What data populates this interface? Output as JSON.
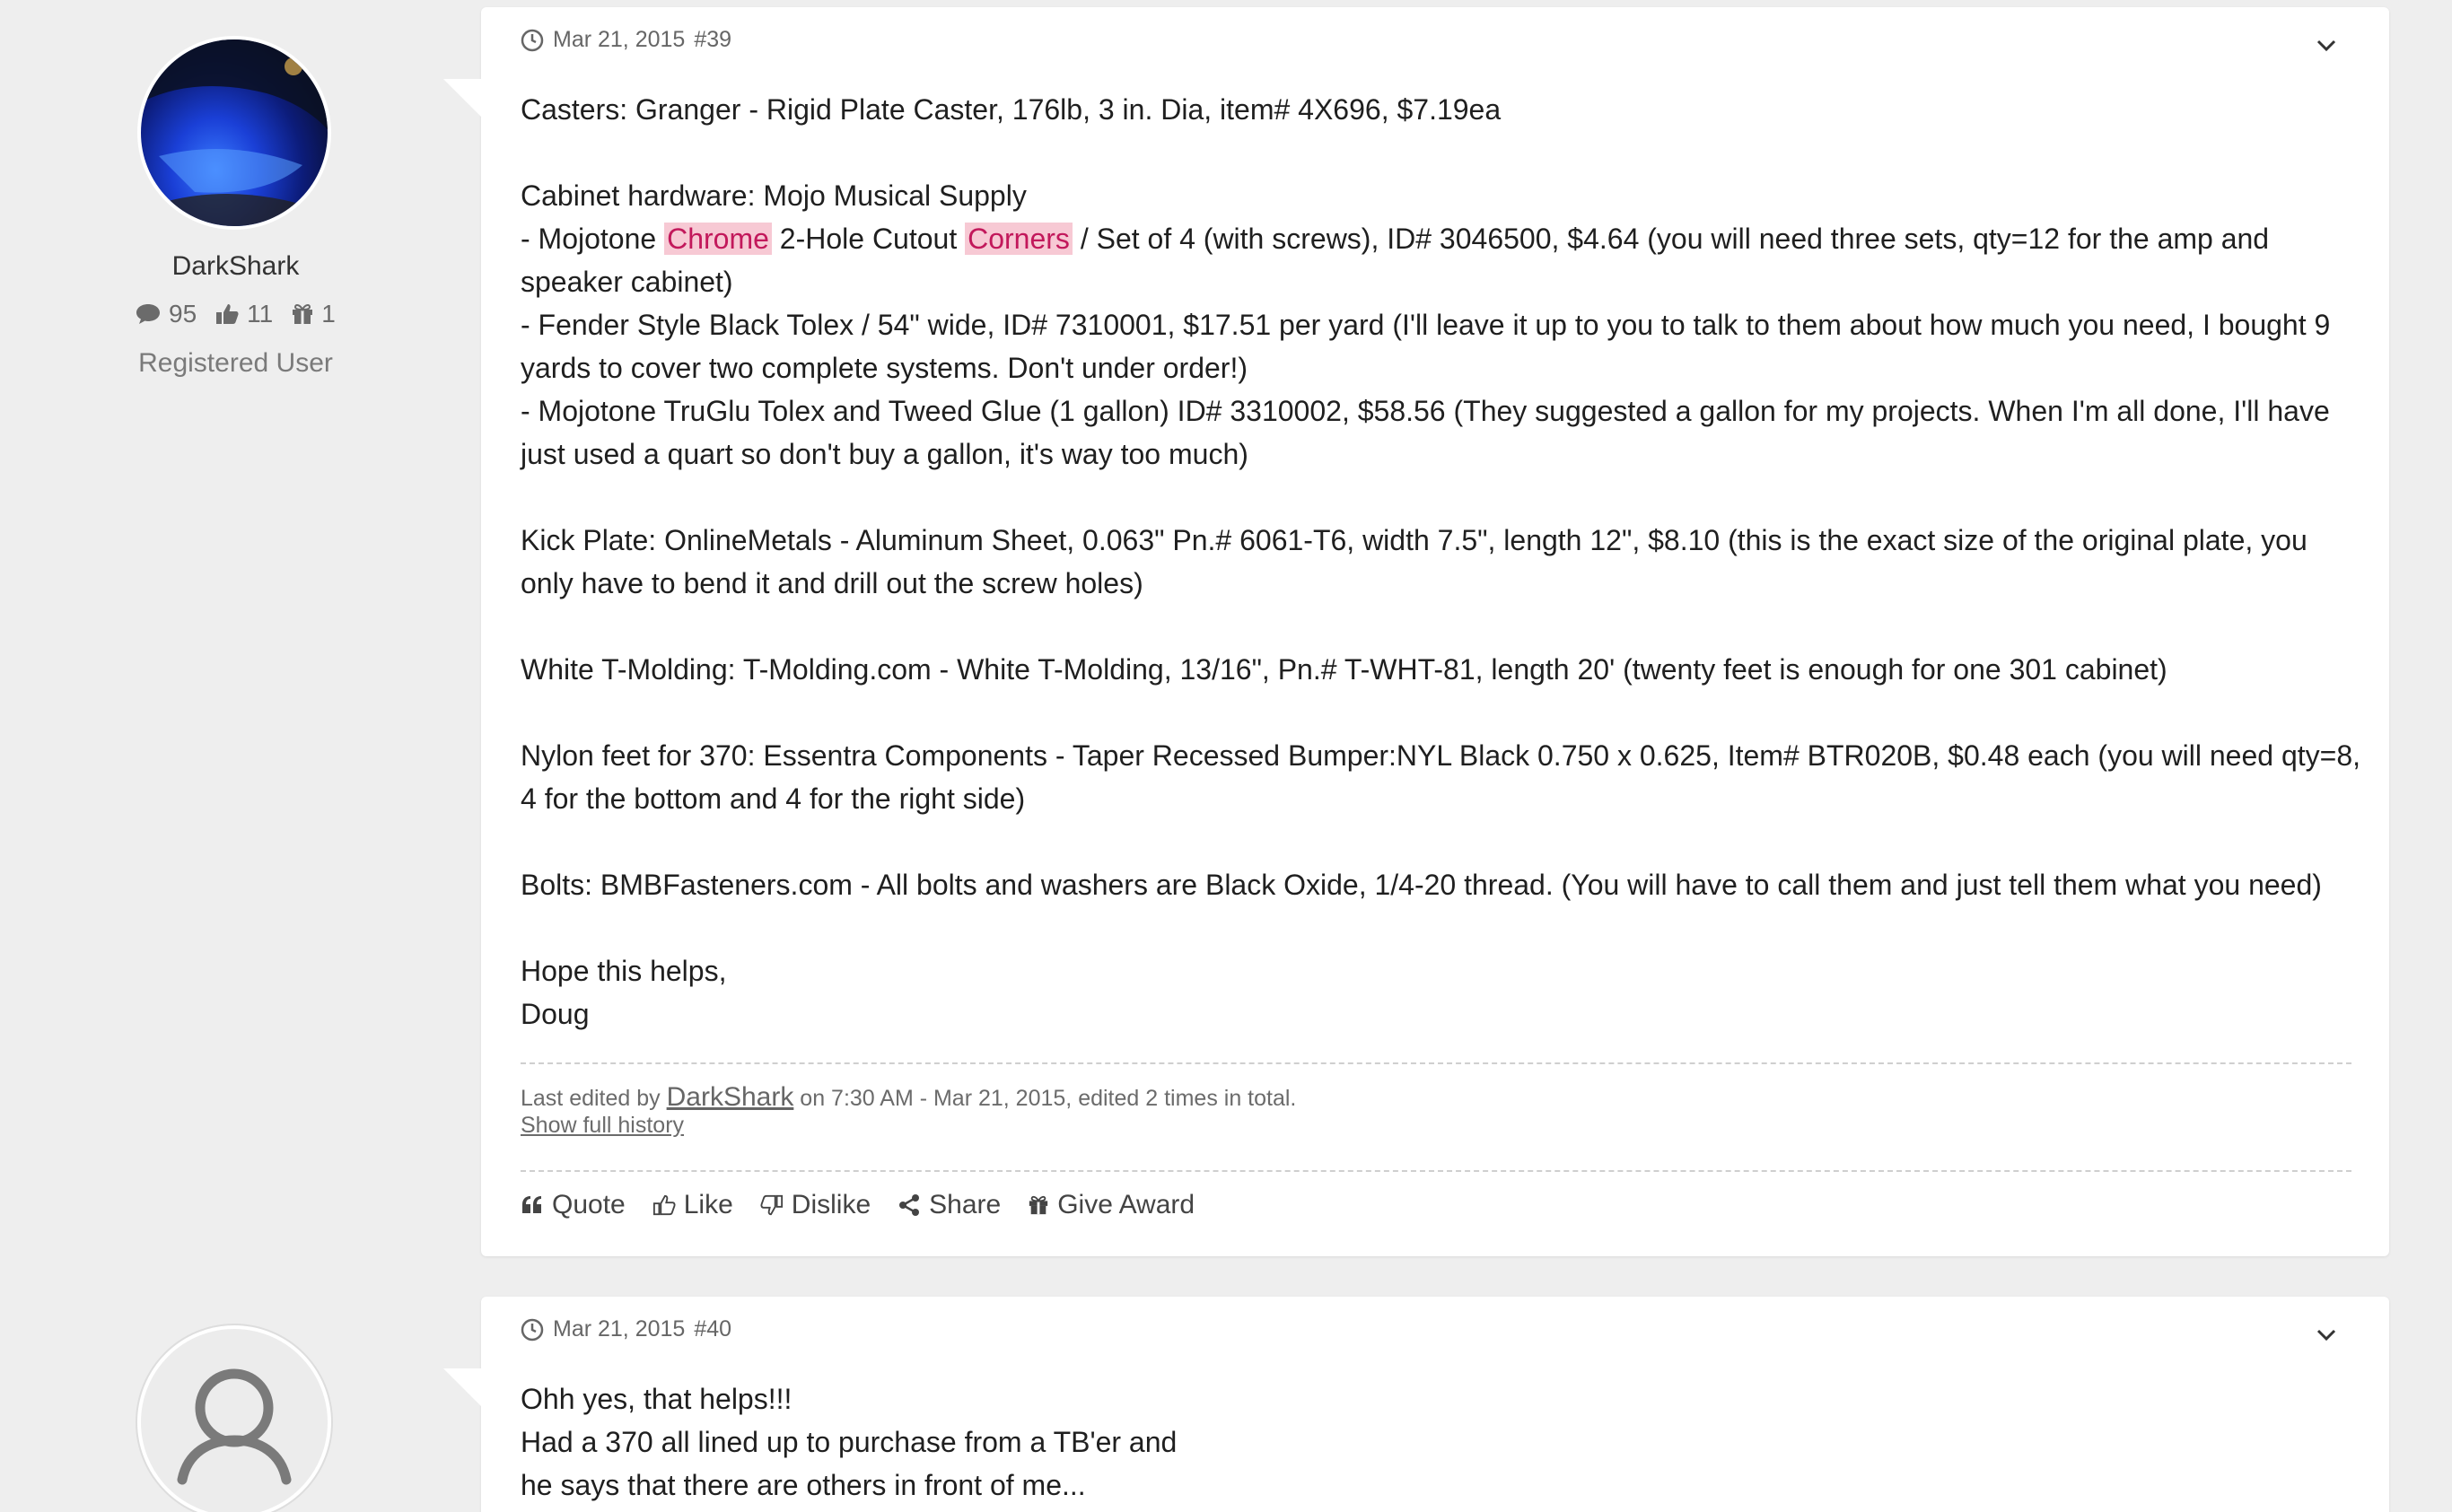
{
  "posts": [
    {
      "user": {
        "name": "DarkShark",
        "posts_count": "95",
        "likes_count": "11",
        "awards_count": "1",
        "role": "Registered User",
        "avatar_icon": "user-photo-avatar"
      },
      "date": "Mar 21, 2015",
      "number": "#39",
      "body": {
        "line1": "Casters: Granger - Rigid Plate Caster, 176lb, 3 in. Dia, item# 4X696, $7.19ea",
        "line2": "Cabinet hardware: Mojo Musical Supply",
        "line3_pre": "- Mojotone ",
        "line3_hl1": "Chrome",
        "line3_mid": " 2-Hole Cutout ",
        "line3_hl2": "Corners",
        "line3_post": " / Set of 4 (with screws), ID# 3046500, $4.64 (you will need three sets, qty=12 for the amp and speaker cabinet)",
        "line4": "- Fender Style Black Tolex / 54\" wide, ID# 7310001, $17.51 per yard (I'll leave it up to you to talk to them about how much you need, I bought 9 yards to cover two complete systems. Don't under order!)",
        "line5": "- Mojotone TruGlu Tolex and Tweed Glue (1 gallon) ID# 3310002, $58.56 (They suggested a gallon for my projects. When I'm all done, I'll have just used a quart so don't buy a gallon, it's way too much)",
        "line6": "Kick Plate: OnlineMetals - Aluminum Sheet, 0.063\" Pn.# 6061-T6, width 7.5\", length 12\", $8.10 (this is the exact size of the original plate, you only have to bend it and drill out the screw holes)",
        "line7": "White T-Molding: T-Molding.com - White T-Molding, 13/16\", Pn.# T-WHT-81, length 20' (twenty feet is enough for one 301 cabinet)",
        "line8": "Nylon feet for 370: Essentra Components - Taper Recessed Bumper:NYL Black 0.750 x 0.625, Item# BTR020B, $0.48 each (you will need qty=8, 4 for the bottom and 4 for the right side)",
        "line9": "Bolts: BMBFasteners.com - All bolts and washers are Black Oxide, 1/4-20 thread. (You will have to call them and just tell them what you need)",
        "line10": "Hope this helps,",
        "line11": "Doug"
      },
      "edit": {
        "prefix": "Last edited by ",
        "editor": "DarkShark",
        "suffix": " on 7:30 AM - Mar 21, 2015, edited 2 times in total.",
        "history_link": "Show full history"
      },
      "actions": {
        "quote": "Quote",
        "like": "Like",
        "dislike": "Dislike",
        "share": "Share",
        "award": "Give Award"
      }
    },
    {
      "user": {
        "avatar_icon": "default-user-avatar"
      },
      "date": "Mar 21, 2015",
      "number": "#40",
      "body": {
        "line1": "Ohh yes, that helps!!!",
        "line2": "Had a 370 all lined up to purchase from a TB'er and",
        "line3": "he says that there are others in front of me..."
      }
    }
  ],
  "colors": {
    "background": "#eeeeee",
    "card": "#ffffff",
    "highlight_bg": "#f7c9d4",
    "highlight_text": "#c2185b"
  }
}
